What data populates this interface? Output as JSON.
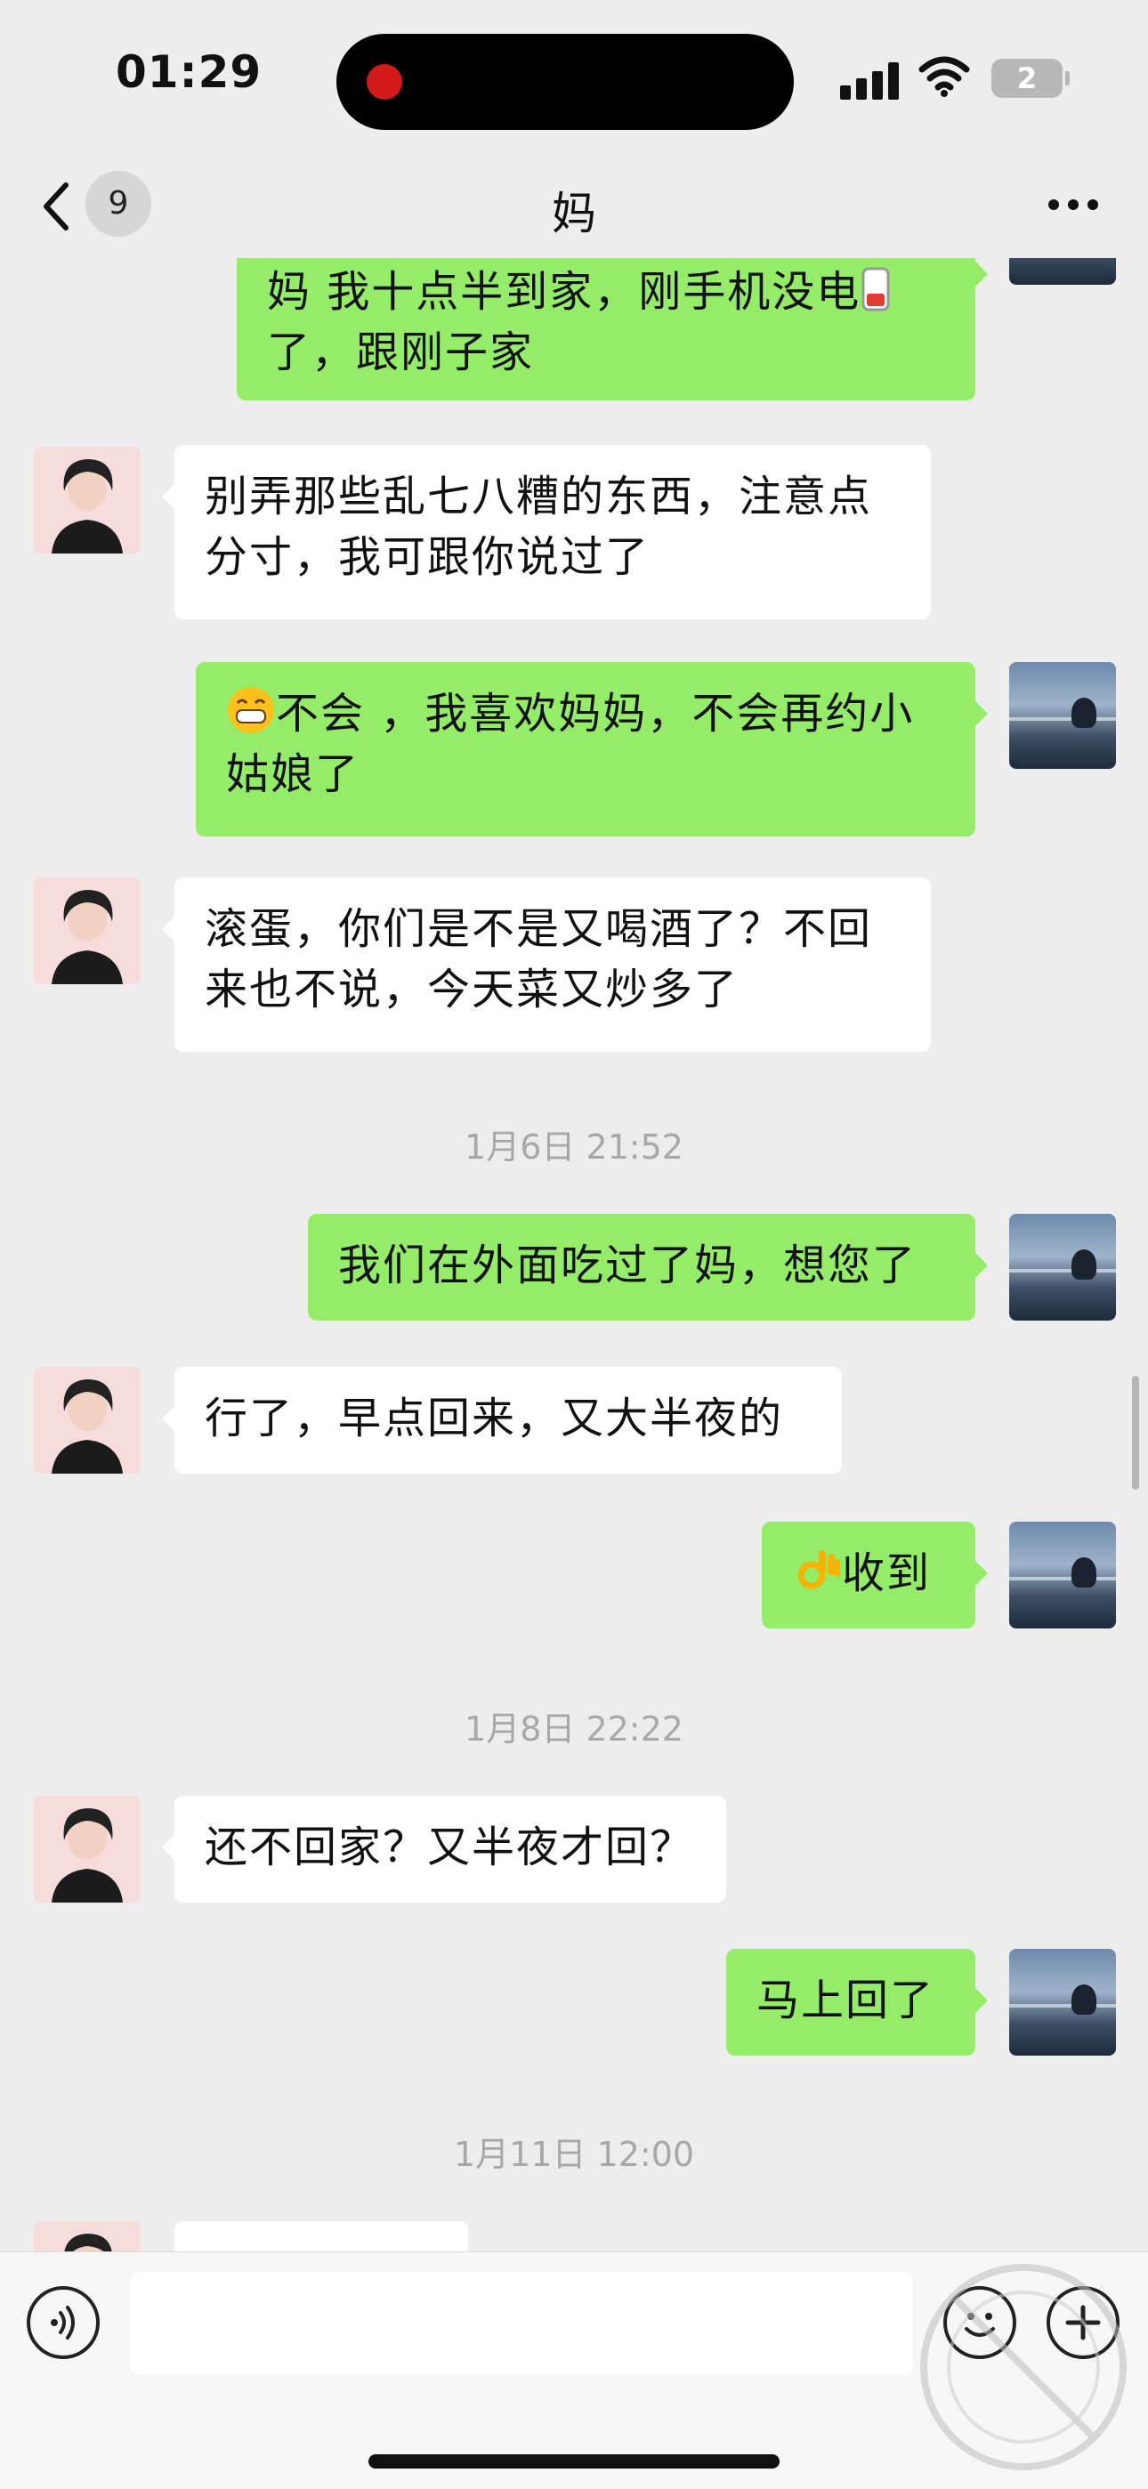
{
  "status_bar": {
    "time": "01:29",
    "battery_level": "2",
    "icons": [
      "signal-icon",
      "wifi-icon",
      "battery-icon"
    ]
  },
  "nav": {
    "back_badge": "9",
    "title": "妈",
    "icons": [
      "back-icon",
      "more-icon"
    ]
  },
  "messages": [
    {
      "from": "me",
      "text": "妈 我十点半到家，刚手机没电",
      "emoji_after": "low-battery-emoji",
      "text2": "了，跟刚子家"
    },
    {
      "from": "mom",
      "text": "别弄那些乱七八糟的东西，注意点分寸，我可跟你说过了"
    },
    {
      "from": "me",
      "emoji_before": "grin-emoji",
      "text": "不会 ，我喜欢妈妈，不会再约小姑娘了"
    },
    {
      "from": "mom",
      "text": "滚蛋，你们是不是又喝酒了？不回来也不说，今天菜又炒多了"
    },
    {
      "type": "timestamp",
      "text": "1月6日 21:52"
    },
    {
      "from": "me",
      "text": "我们在外面吃过了妈，想您了"
    },
    {
      "from": "mom",
      "text": "行了，早点回来，又大半夜的"
    },
    {
      "from": "me",
      "emoji_before": "ok-hand-emoji",
      "text": "收到"
    },
    {
      "type": "timestamp",
      "text": "1月8日 22:22"
    },
    {
      "from": "mom",
      "text": "还不回家？又半夜才回？"
    },
    {
      "from": "me",
      "text": "马上回了"
    },
    {
      "type": "timestamp",
      "text": "1月11日 12:00"
    },
    {
      "from": "mom",
      "text": ""
    }
  ],
  "input_bar": {
    "value": "",
    "icons": [
      "voice-icon",
      "emoji-icon",
      "plus-icon"
    ]
  },
  "colors": {
    "background": "#ededed",
    "outgoing_bubble": "#95ec69",
    "incoming_bubble": "#ffffff",
    "timestamp": "#a8a8a8"
  }
}
